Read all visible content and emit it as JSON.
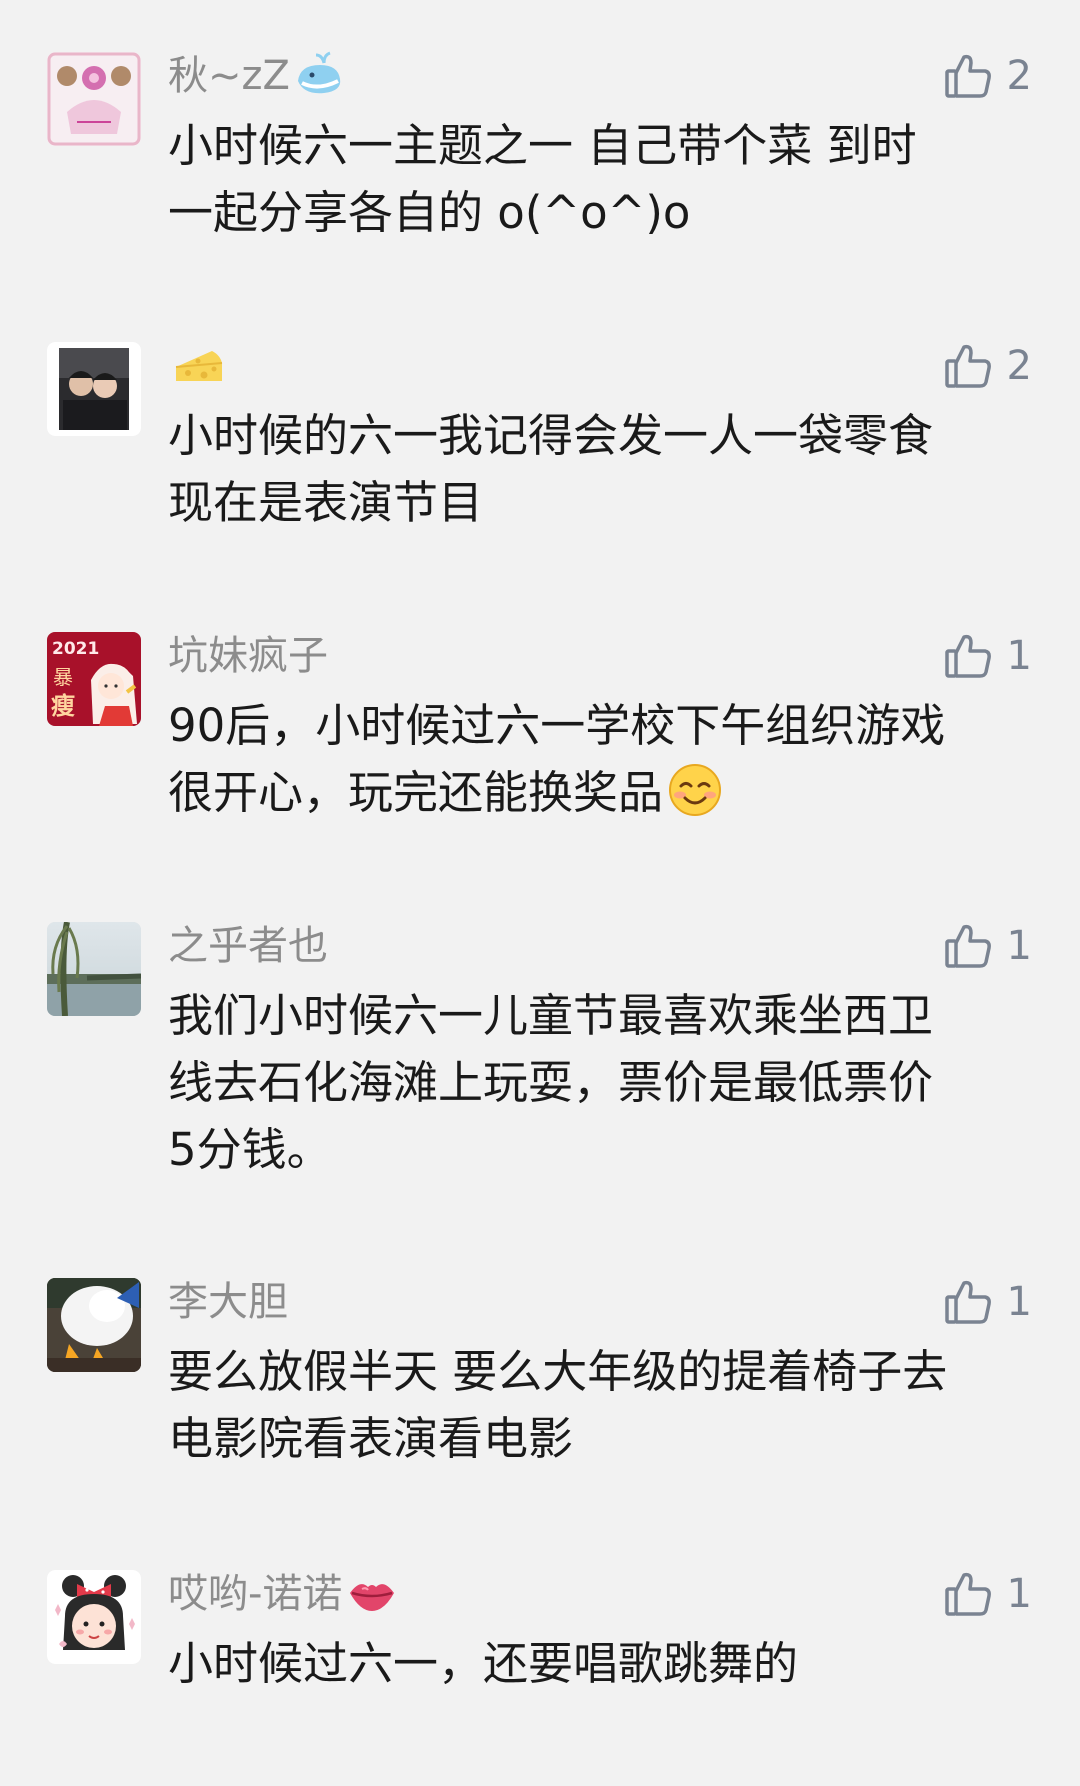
{
  "comments": [
    {
      "name": "秋~zZ",
      "name_icon": "whale-icon",
      "likes": "2",
      "lines": [
        "小时候六一主题之一 自己带个菜 到时",
        "一起分享各自的 o(^o^)o"
      ]
    },
    {
      "name": "",
      "name_icon": "cheese-icon",
      "likes": "2",
      "lines": [
        "小时候的六一我记得会发一人一袋零食",
        "现在是表演节目"
      ]
    },
    {
      "name": "坑妹疯子",
      "likes": "1",
      "lines": [
        "90后，小时候过六一学校下午组织游戏",
        "很开心，玩完还能换奖品"
      ],
      "trailing_icon": "smiling-face-icon"
    },
    {
      "name": "之乎者也",
      "likes": "1",
      "lines": [
        "我们小时候六一儿童节最喜欢乘坐西卫",
        "线去石化海滩上玩耍，票价是最低票价",
        "5分钱。"
      ]
    },
    {
      "name": "李大胆",
      "likes": "1",
      "lines": [
        "要么放假半天 要么大年级的提着椅子去",
        "电影院看表演看电影"
      ]
    },
    {
      "name": "哎哟-诺诺",
      "name_icon": "lips-icon",
      "likes": "1",
      "lines": [
        "小时候过六一，还要唱歌跳舞的"
      ]
    }
  ],
  "avatar_badge": {
    "year": "2021",
    "chars": [
      "暴",
      "瘦"
    ]
  },
  "colors": {
    "background": "#f2f2f2",
    "name": "#8c8c8c",
    "text": "#1a1a1a",
    "like": "#7a8391"
  }
}
